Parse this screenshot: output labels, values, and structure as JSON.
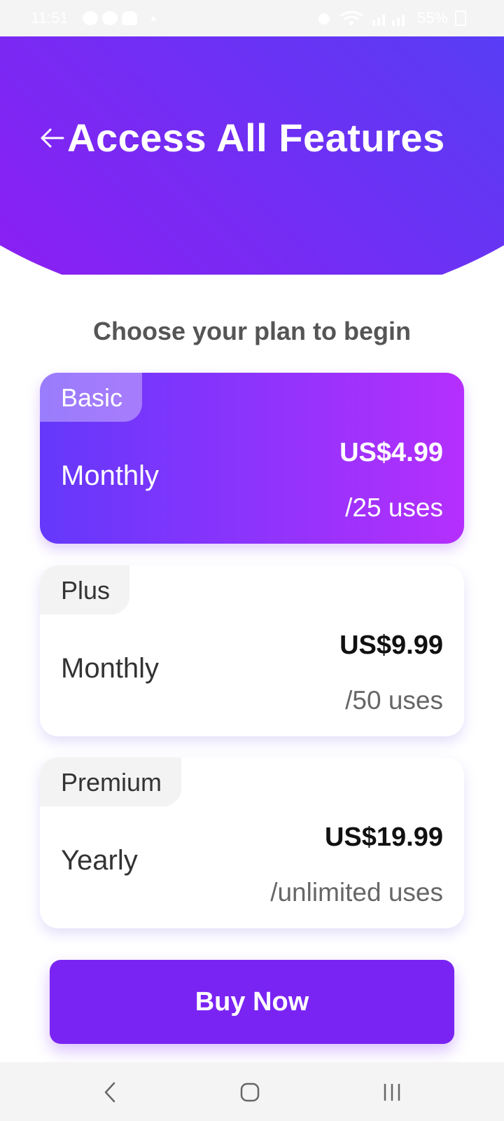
{
  "status_bar": {
    "time": "11:51",
    "battery": "55%",
    "icons": [
      "chat-bubble-icon",
      "messenger-icon",
      "person-icon",
      "dot-icon",
      "alarm-icon",
      "wifi-icon",
      "signal-icon",
      "battery-icon"
    ]
  },
  "header": {
    "title": "Access All Features",
    "back_icon": "arrow-left-icon",
    "gradient_colors": [
      "#9a16f2",
      "#5f39f4",
      "#2f5cff"
    ]
  },
  "subtitle": "Choose your plan to begin",
  "plans": [
    {
      "tag": "Basic",
      "period": "Monthly",
      "price": "US$4.99",
      "uses": "/25 uses",
      "selected": true
    },
    {
      "tag": "Plus",
      "period": "Monthly",
      "price": "US$9.99",
      "uses": "/50 uses",
      "selected": false
    },
    {
      "tag": "Premium",
      "period": "Yearly",
      "price": "US$19.99",
      "uses": "/unlimited uses",
      "selected": false
    }
  ],
  "buy_button": {
    "label": "Buy Now",
    "color": "#7a24f3"
  },
  "nav_bar": {
    "icons": [
      "back-chevron-icon",
      "home-icon",
      "recents-icon"
    ]
  }
}
